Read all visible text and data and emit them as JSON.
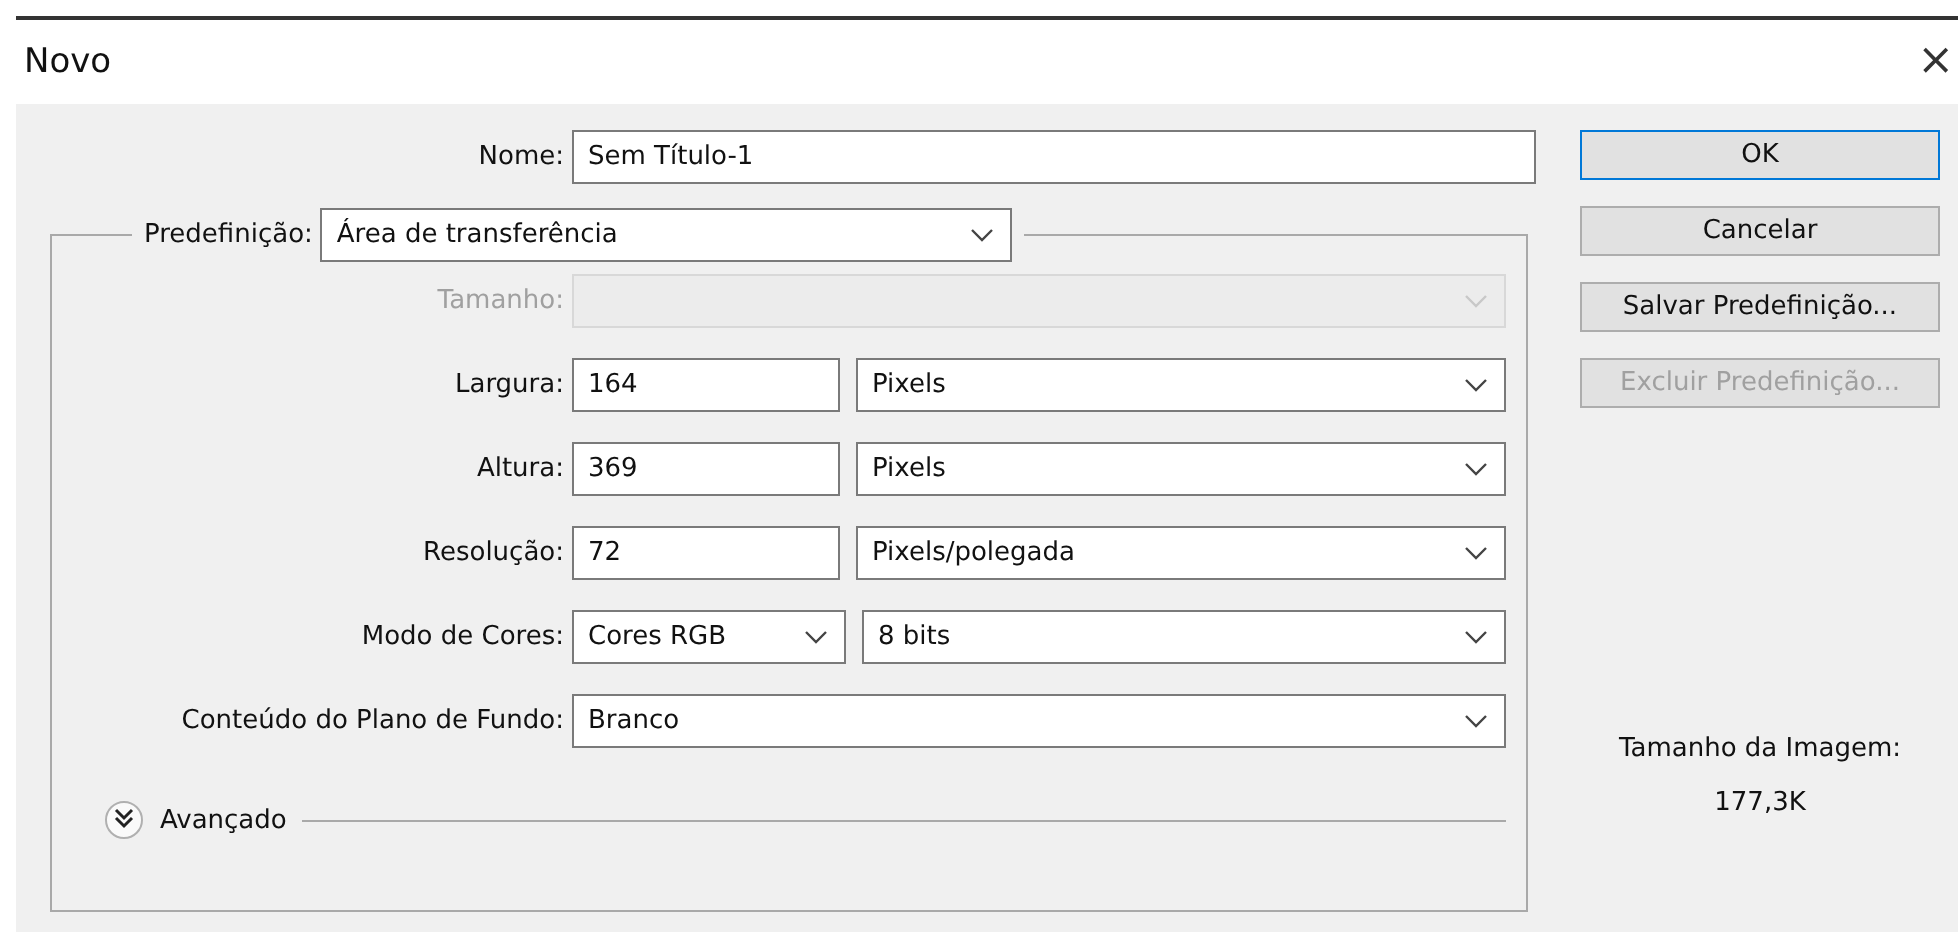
{
  "window": {
    "title": "Novo",
    "close": "×"
  },
  "name": {
    "label": "Nome:",
    "value": "Sem Título-1"
  },
  "preset": {
    "label": "Predefinição:",
    "value": "Área de transferência"
  },
  "rows": [
    {
      "kind": "select",
      "label": "Tamanho:",
      "disabled": true
    },
    {
      "kind": "unit",
      "label": "Largura:",
      "value": "164",
      "unit": "Pixels",
      "disabled": false
    },
    {
      "kind": "unit",
      "label": "Altura:",
      "value": "369",
      "unit": "Pixels",
      "disabled": false
    },
    {
      "kind": "unit",
      "label": "Resolução:",
      "value": "72",
      "unit": "Pixels/polegada",
      "disabled": false
    },
    {
      "kind": "pair",
      "label": "Modo de Cores:",
      "value": "Cores RGB",
      "value2": "8 bits",
      "disabled": false
    },
    {
      "kind": "select",
      "label": "Conteúdo do Plano de Fundo:",
      "value": "Branco",
      "disabled": false
    }
  ],
  "advanced": {
    "label": "Avançado",
    "expanded": false
  },
  "buttons": [
    {
      "label": "OK",
      "default": true,
      "disabled": false
    },
    {
      "label": "Cancelar",
      "default": false,
      "disabled": false
    },
    {
      "label": "Salvar Predefinição...",
      "default": false,
      "disabled": false
    },
    {
      "label": "Excluir Predefinição...",
      "default": false,
      "disabled": true
    }
  ],
  "image_size": {
    "label": "Tamanho da Imagem:",
    "value": "177,3K"
  }
}
